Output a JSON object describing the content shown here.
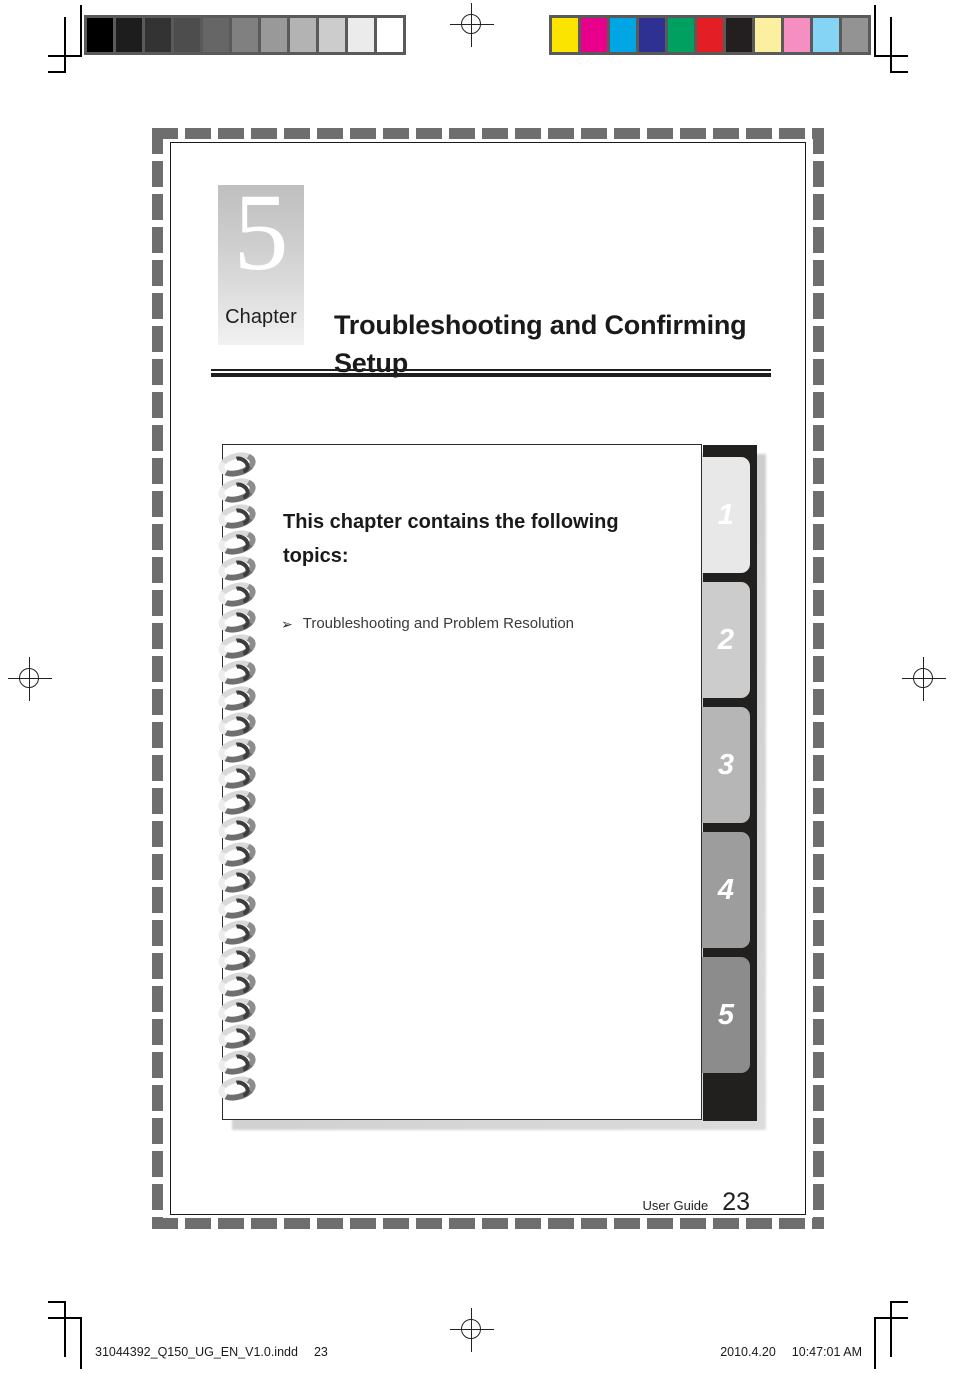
{
  "document": {
    "chapter_number": "5",
    "chapter_word": "Chapter",
    "chapter_title": "Troubleshooting and Confirming Setup"
  },
  "notebook": {
    "heading": "This chapter contains the following topics:",
    "bullet_glyph": "➢",
    "topics": [
      {
        "label": "Troubleshooting and Problem Resolution"
      }
    ],
    "tabs": [
      {
        "label": "1",
        "color": "#e8e8e8"
      },
      {
        "label": "2",
        "color": "#cccccc"
      },
      {
        "label": "3",
        "color": "#b6b6b6"
      },
      {
        "label": "4",
        "color": "#9d9d9d"
      },
      {
        "label": "5",
        "color": "#8c8c8c"
      }
    ],
    "tab_column_color": "#221f1f"
  },
  "footer": {
    "label": "User Guide",
    "page_number": "23"
  },
  "print_slug": {
    "filename": "31044392_Q150_UG_EN_V1.0.indd",
    "page": "23",
    "date": "2010.4.20",
    "time": "10:47:01 AM"
  },
  "calibration": {
    "gray_strip_name": "grayscale-calibration-bar",
    "gray_swatches": [
      "#000000",
      "#1d1d1d",
      "#333333",
      "#4d4d4d",
      "#666666",
      "#808080",
      "#999999",
      "#b3b3b3",
      "#cccccc",
      "#ebebeb",
      "#ffffff"
    ],
    "color_strip_name": "color-calibration-bar",
    "color_swatches": [
      "#fbe400",
      "#e8008c",
      "#00a5e3",
      "#2e3192",
      "#00a160",
      "#e31e24",
      "#231f20",
      "#fbefa0",
      "#f58ec1",
      "#85d4f5",
      "#939393"
    ]
  },
  "marks": {
    "registration_icon": "registration-target-icon",
    "crop_icon": "crop-mark-icon"
  }
}
